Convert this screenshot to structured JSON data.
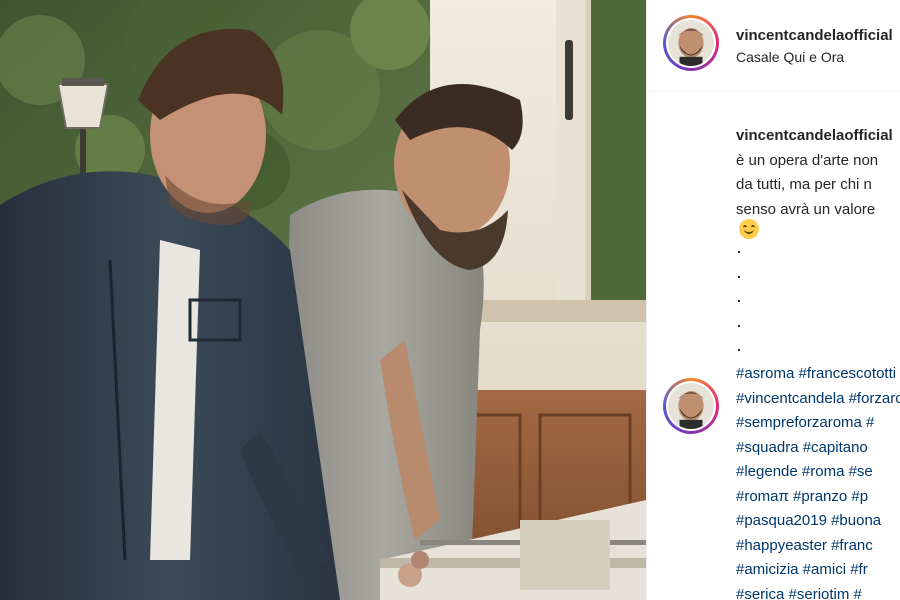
{
  "post": {
    "username": "vincentcandelaofficial",
    "location": "Casale Qui e Ora"
  },
  "caption": {
    "username": "vincentcandelaofficial",
    "lines": [
      "è un opera d'arte non",
      "da tutti, ma per chi n",
      "senso avrà un valore"
    ],
    "emoji": "smiling-face-icon",
    "dots": [
      ".",
      ".",
      ".",
      ".",
      "."
    ]
  },
  "hashtags": [
    "#asroma #francescototti",
    "#vincentcandela #forzaroma",
    "#sempreforzaroma #",
    "#squadra #capitano",
    "#legende #roma #se",
    "#romaπ #pranzo #p",
    "#pasqua2019 #buona",
    "#happyeaster #franc",
    "#amicizia #amici #fr",
    "#serica #seriotim #"
  ],
  "colors": {
    "text": "#262626",
    "hashtag": "#00376b",
    "divider": "#efefef"
  }
}
